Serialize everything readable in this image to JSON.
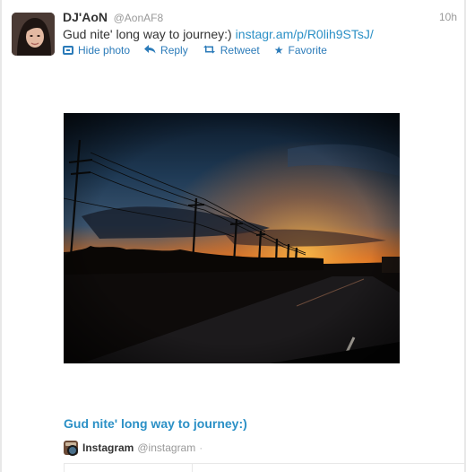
{
  "tweet": {
    "fullname": "DJ'AoN",
    "username": "@AonAF8",
    "timestamp": "10h",
    "text": "Gud nite' long way to journey:)",
    "link_text": "instagr.am/p/R0lih9STsJ/"
  },
  "actions": {
    "hide_photo": "Hide photo",
    "reply": "Reply",
    "retweet": "Retweet",
    "favorite": "Favorite"
  },
  "icons": {
    "avatar": "user-avatar",
    "hide_photo": "photo-icon",
    "reply": "reply-arrow-icon",
    "retweet": "retweet-icon",
    "favorite": "star-icon",
    "source": "instagram-camera-icon"
  },
  "card": {
    "title": "Gud nite' long way to journey:)",
    "source_name": "Instagram",
    "source_handle": "@instagram",
    "source_separator": "·"
  },
  "colors": {
    "link": "#2b90c6",
    "action": "#2b7bb9",
    "muted": "#999999",
    "sky_orange": "#f08a1e",
    "sky_blue": "#24425e"
  }
}
